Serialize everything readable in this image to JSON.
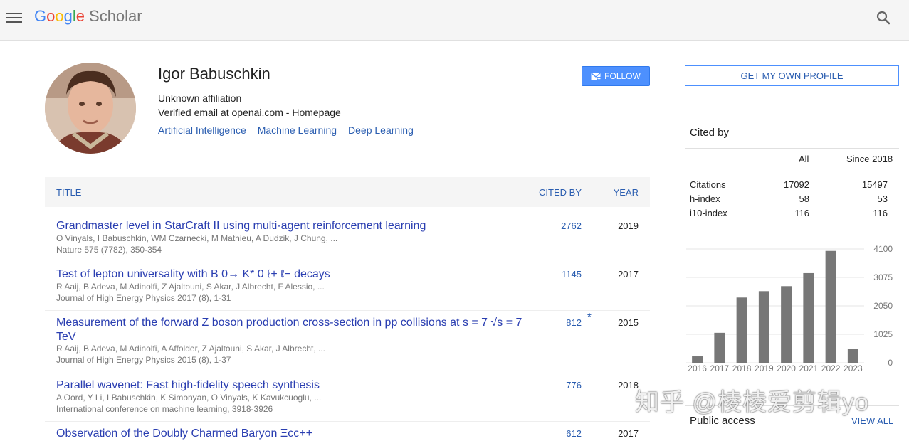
{
  "header": {
    "logo_google": [
      "G",
      "o",
      "o",
      "g",
      "l",
      "e"
    ],
    "logo_scholar": "Scholar"
  },
  "profile": {
    "name": "Igor Babuschkin",
    "affiliation": "Unknown affiliation",
    "email_text": "Verified email at openai.com - ",
    "homepage_label": "Homepage",
    "interests": [
      "Artificial Intelligence",
      "Machine Learning",
      "Deep Learning"
    ],
    "follow_label": "FOLLOW"
  },
  "table": {
    "col_title": "TITLE",
    "col_cited": "CITED BY",
    "col_year": "YEAR",
    "rows": [
      {
        "title": "Grandmaster level in StarCraft II using multi-agent reinforcement learning",
        "authors": "O Vinyals, I Babuschkin, WM Czarnecki, M Mathieu, A Dudzik, J Chung, ...",
        "venue": "Nature 575 (7782), 350-354",
        "cited": "2762",
        "star": "",
        "year": "2019"
      },
      {
        "title": "Test of lepton universality with B 0→ K* 0 ℓ+ ℓ− decays",
        "authors": "R Aaij, B Adeva, M Adinolfi, Z Ajaltouni, S Akar, J Albrecht, F Alessio, ...",
        "venue": "Journal of High Energy Physics 2017 (8), 1-31",
        "cited": "1145",
        "star": "",
        "year": "2017"
      },
      {
        "title": "Measurement of the forward Z boson production cross-section in pp collisions at s = 7 √s = 7 TeV",
        "authors": "R Aaij, B Adeva, M Adinolfi, A Affolder, Z Ajaltouni, S Akar, J Albrecht, ...",
        "venue": "Journal of High Energy Physics 2015 (8), 1-37",
        "cited": "812",
        "star": "*",
        "year": "2015"
      },
      {
        "title": "Parallel wavenet: Fast high-fidelity speech synthesis",
        "authors": "A Oord, Y Li, I Babuschkin, K Simonyan, O Vinyals, K Kavukcuoglu, ...",
        "venue": "International conference on machine learning, 3918-3926",
        "cited": "776",
        "star": "",
        "year": "2018"
      },
      {
        "title": "Observation of the Doubly Charmed Baryon Ξcc++",
        "authors": "",
        "venue": "",
        "cited": "612",
        "star": "",
        "year": "2017"
      }
    ]
  },
  "sidebar": {
    "get_profile_label": "GET MY OWN PROFILE",
    "cited_by_title": "Cited by",
    "col_all": "All",
    "col_since": "Since 2018",
    "stats": [
      {
        "label": "Citations",
        "all": "17092",
        "since": "15497"
      },
      {
        "label": "h-index",
        "all": "58",
        "since": "53"
      },
      {
        "label": "i10-index",
        "all": "116",
        "since": "116"
      }
    ],
    "public_access": "Public access",
    "view_all": "VIEW ALL"
  },
  "chart_data": {
    "type": "bar",
    "categories": [
      "2016",
      "2017",
      "2018",
      "2019",
      "2020",
      "2021",
      "2022",
      "2023"
    ],
    "values": [
      230,
      1080,
      2350,
      2580,
      2760,
      3230,
      4030,
      500
    ],
    "yticks": [
      "4100",
      "3075",
      "2050",
      "1025",
      "0"
    ],
    "ylim": [
      0,
      4100
    ]
  },
  "watermark": "知乎 @棱棱爱剪辑yo",
  "colors": {
    "accent": "#4d90fe",
    "link": "#2a5db0",
    "bar": "#777777"
  }
}
